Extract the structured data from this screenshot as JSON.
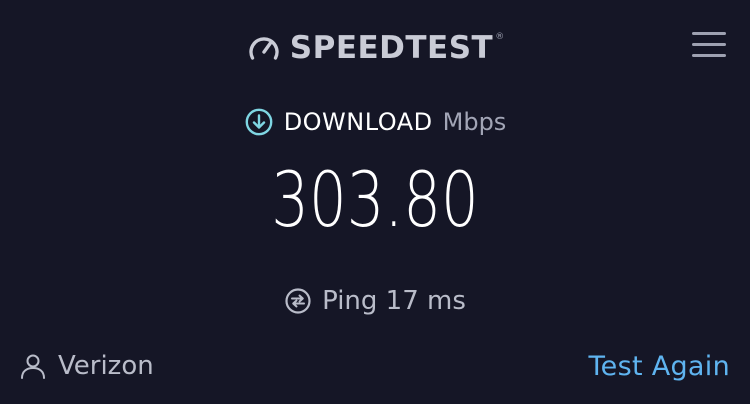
{
  "header": {
    "logo_text": "SPEEDTEST",
    "trademark": "®",
    "menu_icon": "hamburger-menu-icon"
  },
  "result": {
    "direction_icon": "download-arrow-icon",
    "direction_label": "DOWNLOAD",
    "unit": "Mbps",
    "speed": "303.80"
  },
  "ping": {
    "icon": "ping-icon",
    "text": "Ping 17 ms"
  },
  "footer": {
    "provider_icon": "user-icon",
    "provider_name": "Verizon",
    "test_again_label": "Test Again"
  },
  "colors": {
    "background": "#151626",
    "accent_blue": "#5fb4f0",
    "download_icon": "#7fd6e3",
    "muted_text": "#b9bcc9"
  }
}
